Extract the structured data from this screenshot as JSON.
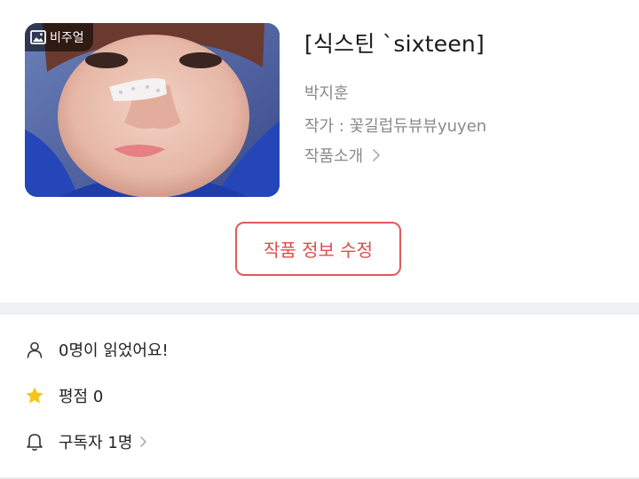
{
  "cover": {
    "badge_label": "비주얼",
    "badge_icon": "image-icon"
  },
  "work": {
    "title": "[식스틴 `sixteen]",
    "hero": "박지훈",
    "author": "작가 : 꽃길럽듀뷰뷰yuyen",
    "intro_label": "작품소개"
  },
  "actions": {
    "edit_label": "작품 정보 수정"
  },
  "stats": {
    "views_text": "0명이 읽었어요!",
    "rating_text": "평점 0",
    "subscribers_text": "구독자 1명"
  },
  "colors": {
    "accent": "#e04b4b",
    "star": "#f5c518",
    "muted_text": "#8a8a8a",
    "divider": "#f0f1f3"
  }
}
